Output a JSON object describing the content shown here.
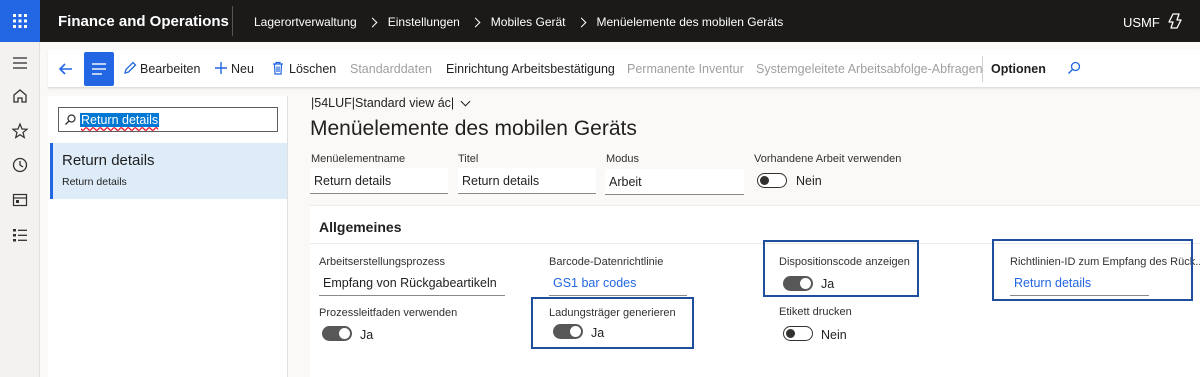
{
  "topbar": {
    "app_title": "Finance and Operations",
    "breadcrumbs": [
      "Lagerortverwaltung",
      "Einstellungen",
      "Mobiles Gerät",
      "Menüelemente des mobilen Geräts"
    ],
    "company": "USMF"
  },
  "actions": {
    "edit": "Bearbeiten",
    "new": "Neu",
    "delete": "Löschen",
    "default_data": "Standarddaten",
    "work_confirmation": "Einrichtung Arbeitsbestätigung",
    "permanent_inventory": "Permanente Inventur",
    "system_directed": "Systemgeleitete Arbeitsabfolge-Abfragen",
    "options": "Optionen"
  },
  "list": {
    "filter_value": "Return details",
    "items": [
      {
        "title": "Return details",
        "subtitle": "Return details"
      }
    ]
  },
  "detail": {
    "view_name": "|54LUF|Standard view ác|",
    "page_title": "Menüelemente des mobilen Geräts",
    "header_fields": {
      "menu_item_name_label": "Menüelementname",
      "menu_item_name_value": "Return details",
      "title_label": "Titel",
      "title_value": "Return details",
      "mode_label": "Modus",
      "mode_value": "Arbeit",
      "use_existing_work_label": "Vorhandene Arbeit verwenden",
      "use_existing_work_value": "Nein"
    },
    "general_tab": {
      "title": "Allgemeines",
      "work_creation_process_label": "Arbeitserstellungsprozess",
      "work_creation_process_value": "Empfang von Rückgabeartikeln",
      "barcode_policy_label": "Barcode-Datenrichtlinie",
      "barcode_policy_value": "GS1 bar codes",
      "disposition_code_label": "Dispositionscode anzeigen",
      "disposition_code_value": "Ja",
      "policy_id_label": "Richtlinien-ID zum Empfang des Rück...",
      "policy_id_value": "Return details",
      "process_guide_label": "Prozessleitfaden verwenden",
      "process_guide_value": "Ja",
      "generate_lp_label": "Ladungsträger generieren",
      "generate_lp_value": "Ja",
      "print_label_label": "Etikett drucken",
      "print_label_value": "Nein"
    }
  },
  "colors": {
    "brand_blue": "#2266e3",
    "topbar_bg": "#1b1a19",
    "highlight_border": "#1f4e9c"
  }
}
